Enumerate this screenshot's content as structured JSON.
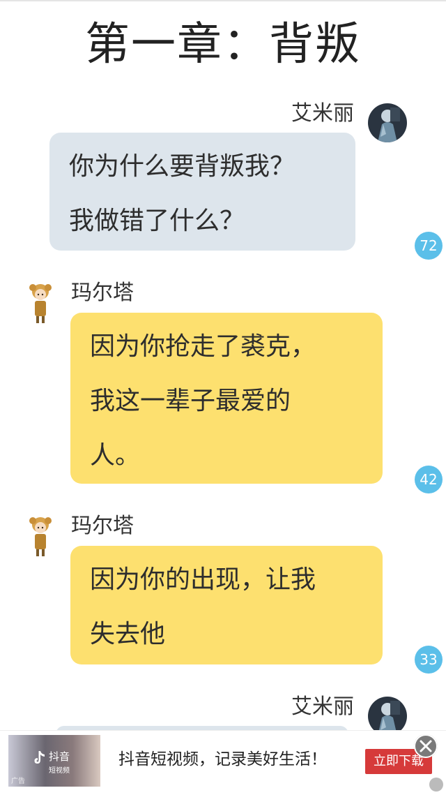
{
  "chapter": {
    "title": "第一章：背叛"
  },
  "messages": [
    {
      "side": "right",
      "sender": "艾米丽",
      "lines": [
        "你为什么要背叛我？",
        "我做错了什么？"
      ],
      "badge": "72"
    },
    {
      "side": "left",
      "sender": "玛尔塔",
      "lines": [
        "因为你抢走了裘克，",
        "我这一辈子最爱的",
        "人。"
      ],
      "badge": "42"
    },
    {
      "side": "left",
      "sender": "玛尔塔",
      "lines": [
        "因为你的出现，让我",
        "失去他"
      ],
      "badge": "33"
    },
    {
      "side": "right",
      "sender": "艾米丽",
      "lines": [],
      "badge": ""
    }
  ],
  "ad": {
    "thumb_logo": "抖音",
    "thumb_sub": "短视频",
    "thumb_tag": "广告",
    "text": "抖音短视频，记录美好生活！",
    "button": "立即下载"
  },
  "colors": {
    "right_bubble": "#dde5ec",
    "left_bubble": "#fde06f",
    "badge": "#5bbfe9",
    "ad_button": "#d63a3a"
  },
  "icons": {
    "right_avatar": "avatar-emily-icon",
    "left_avatar": "avatar-marta-icon",
    "close": "close-icon"
  }
}
